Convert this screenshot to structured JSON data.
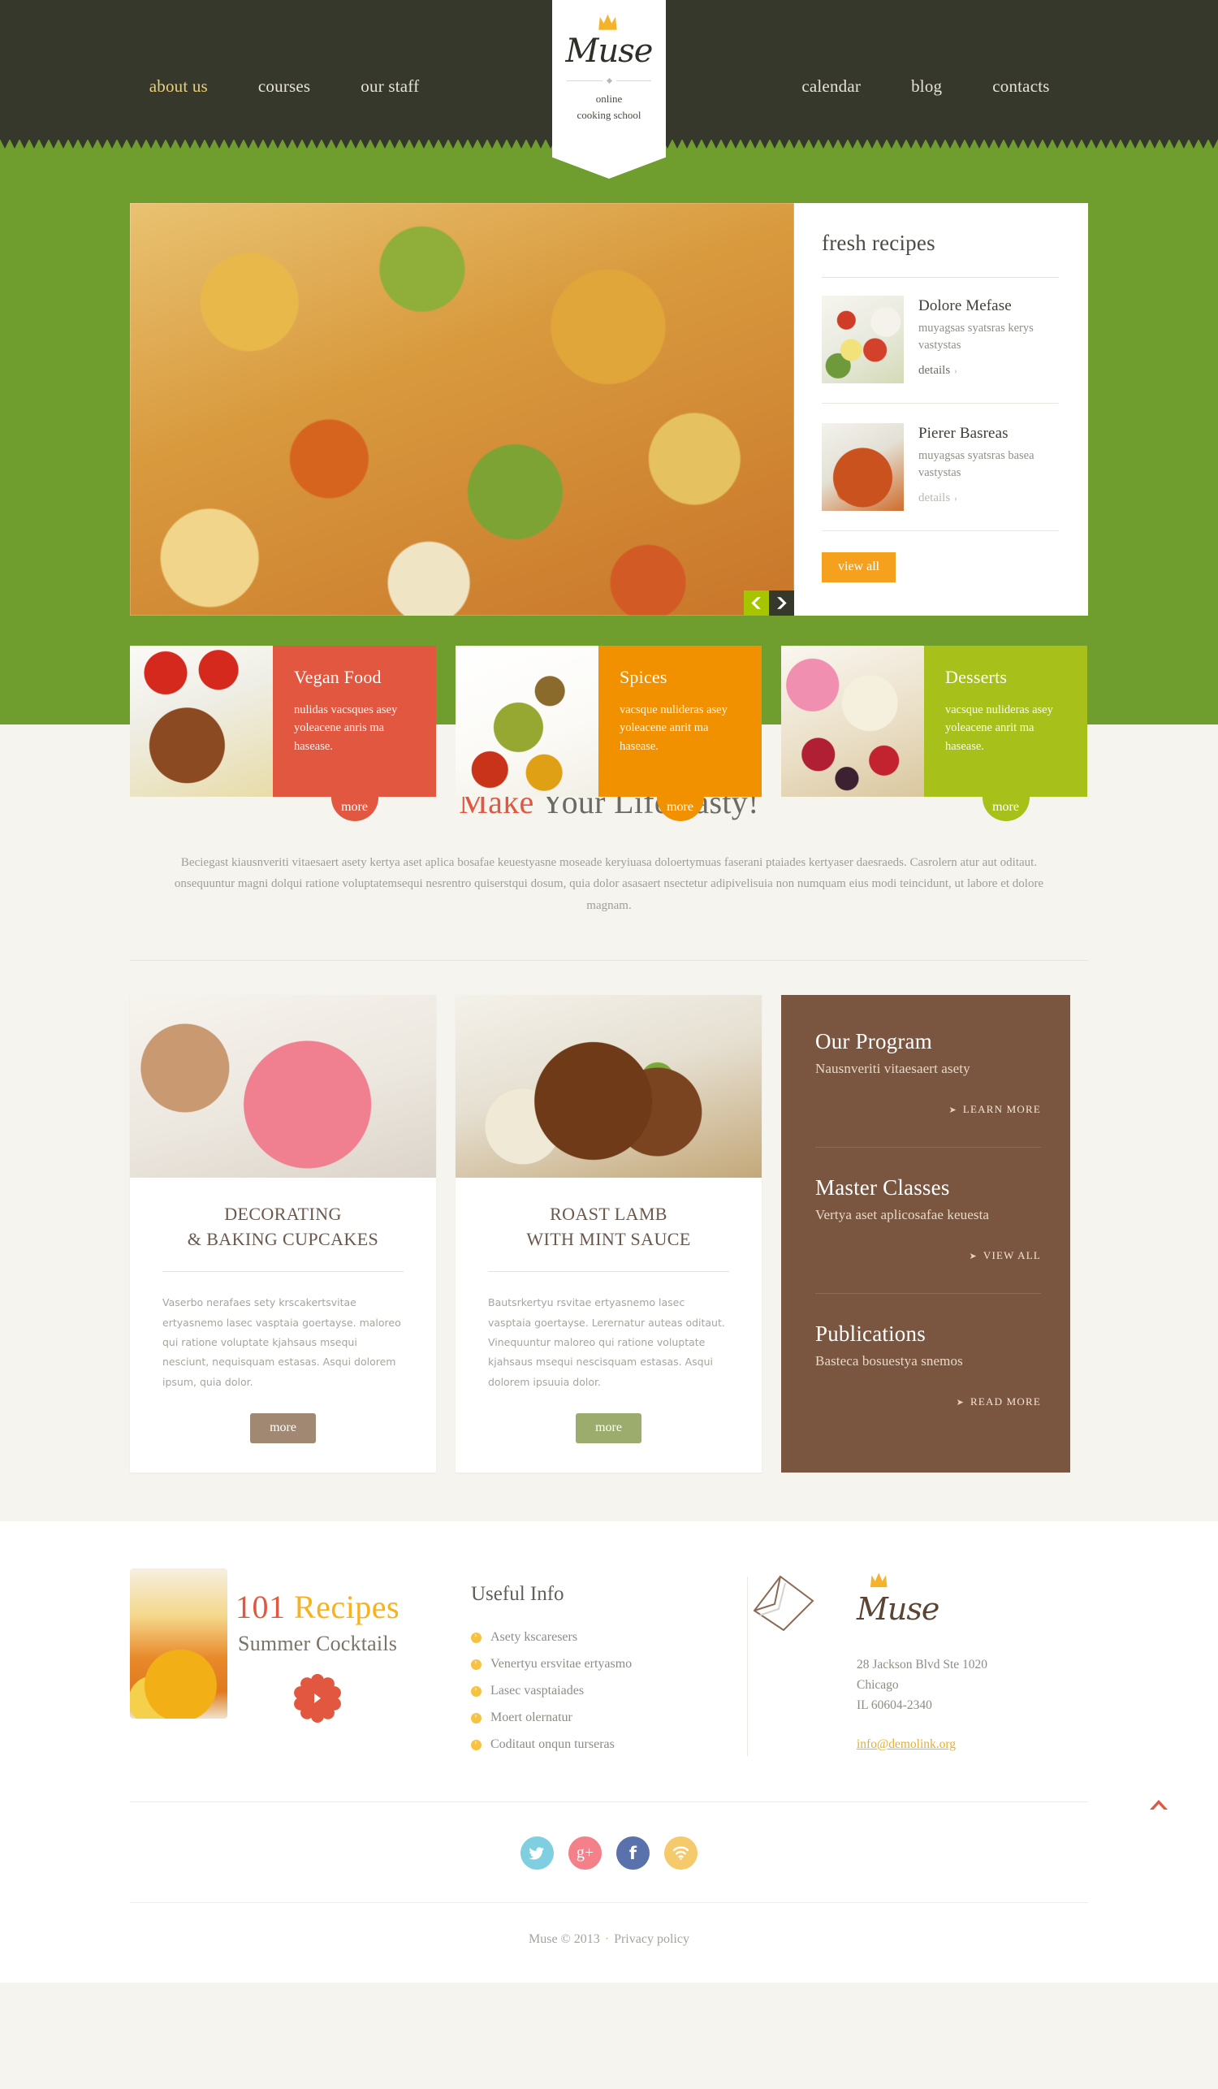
{
  "brand": {
    "name": "Muse",
    "tagline_line1": "online",
    "tagline_line2": "cooking school",
    "crown_icon": "crown-icon"
  },
  "nav": {
    "left": [
      {
        "label": "about us",
        "active": true
      },
      {
        "label": "courses",
        "active": false
      },
      {
        "label": "our staff",
        "active": false
      }
    ],
    "right": [
      {
        "label": "calendar",
        "active": false
      },
      {
        "label": "blog",
        "active": false
      },
      {
        "label": "contacts",
        "active": false
      }
    ]
  },
  "slider": {
    "prev_icon": "chevron-left-icon",
    "next_icon": "chevron-right-icon"
  },
  "fresh": {
    "title": "fresh recipes",
    "items": [
      {
        "title": "Dolore Mefase",
        "desc": "muyagsas syatsras kerys vastystas",
        "link": "details",
        "muted": false
      },
      {
        "title": "Pierer Basreas",
        "desc": "muyagsas syatsras basea vastystas",
        "link": "details",
        "muted": true
      }
    ],
    "view_all": "view all"
  },
  "categories": [
    {
      "title": "Vegan Food",
      "desc": "nulidas vacsques asey yoleacene anris ma hasease.",
      "more": "more",
      "color": "#e2573f"
    },
    {
      "title": "Spices",
      "desc": "vacsque nulideras asey yoleacene anrit ma hasease.",
      "more": "more",
      "color": "#f29100"
    },
    {
      "title": "Desserts",
      "desc": "vacsque nulideras asey yoleacene anrit ma hasease.",
      "more": "more",
      "color": "#a7c01a"
    }
  ],
  "tasty": {
    "title_highlight": "Make",
    "title_rest": " Your Life Tasty!",
    "paragraph": "Beciegast kiausnveriti vitaesaert asety kertya aset aplica bosafae keuestyasne moseade keryiuasa doloertymuas faserani ptaiades kertyaser daesraeds. Casrolern atur aut oditaut. onsequuntur magni dolqui ratione voluptatemsequi nesrentro quiserstqui dosum, quia dolor asasaert nsectetur adipivelisuia non numquam eius modi teincidunt, ut labore et dolore magnam."
  },
  "features": [
    {
      "title_line1": "DECORATING",
      "title_line2": "& BAKING CUPCAKES",
      "body": "Vaserbo nerafaes sety krscakertsvitae ertyasnemo lasec vasptaia goertayse. maloreo qui ratione voluptate kjahsaus msequi nesciunt, nequisquam estasas. Asqui dolorem ipsum, quia dolor.",
      "more": "more",
      "button_color": "#a08872"
    },
    {
      "title_line1": "ROAST LAMB",
      "title_line2": "WITH MINT SAUCE",
      "body": "Bautsrkertyu rsvitae ertyasnemo lasec vasptaia goertayse. Lerernatur auteas oditaut. Vinequuntur maloreo qui ratione voluptate kjahsaus msequi nescisquam estasas. Asqui dolorem ipsuuia dolor.",
      "more": "more",
      "button_color": "#9cac6d"
    }
  ],
  "panel": {
    "background": "#7a5640",
    "blocks": [
      {
        "title": "Our Program",
        "subtitle": "Nausnveriti vitaesaert asety",
        "link": "LEARN MORE"
      },
      {
        "title": "Master Classes",
        "subtitle": "Vertya aset aplicosafae keuesta",
        "link": "VIEW ALL"
      },
      {
        "title": "Publications",
        "subtitle": "Basteca bosuestya snemos",
        "link": "READ MORE"
      }
    ]
  },
  "footer": {
    "promo": {
      "number": "101",
      "word": "Recipes",
      "subtitle": "Summer Cocktails",
      "flower_icon": "flower-arrow-icon"
    },
    "useful": {
      "title": "Useful Info",
      "items": [
        "Asety kscaresers",
        "Venertyu ersvitae ertyasmo",
        "Lasec vasptaiades",
        "Moert olernatur",
        "Coditaut onqun turseras"
      ]
    },
    "contact": {
      "envelope_icon": "envelope-icon",
      "logo": "Muse",
      "address_line1": "28 Jackson Blvd Ste 1020",
      "address_line2": "Chicago",
      "address_line3": "IL 60604-2340",
      "email": "info@demolink.org"
    },
    "social": [
      {
        "name": "twitter-icon",
        "label": "Twitter",
        "color": "#7fcfe0",
        "glyph": ""
      },
      {
        "name": "google-plus-icon",
        "label": "Google Plus",
        "color": "#f4808a",
        "glyph": "g+"
      },
      {
        "name": "facebook-icon",
        "label": "Facebook",
        "color": "#5a72ab",
        "glyph": "f"
      },
      {
        "name": "rss-icon",
        "label": "RSS",
        "color": "#f5ca6a",
        "glyph": ""
      }
    ],
    "copyright": "Muse © 2013",
    "separator": "·",
    "privacy": "Privacy policy",
    "to_top_icon": "chevron-up-icon"
  }
}
